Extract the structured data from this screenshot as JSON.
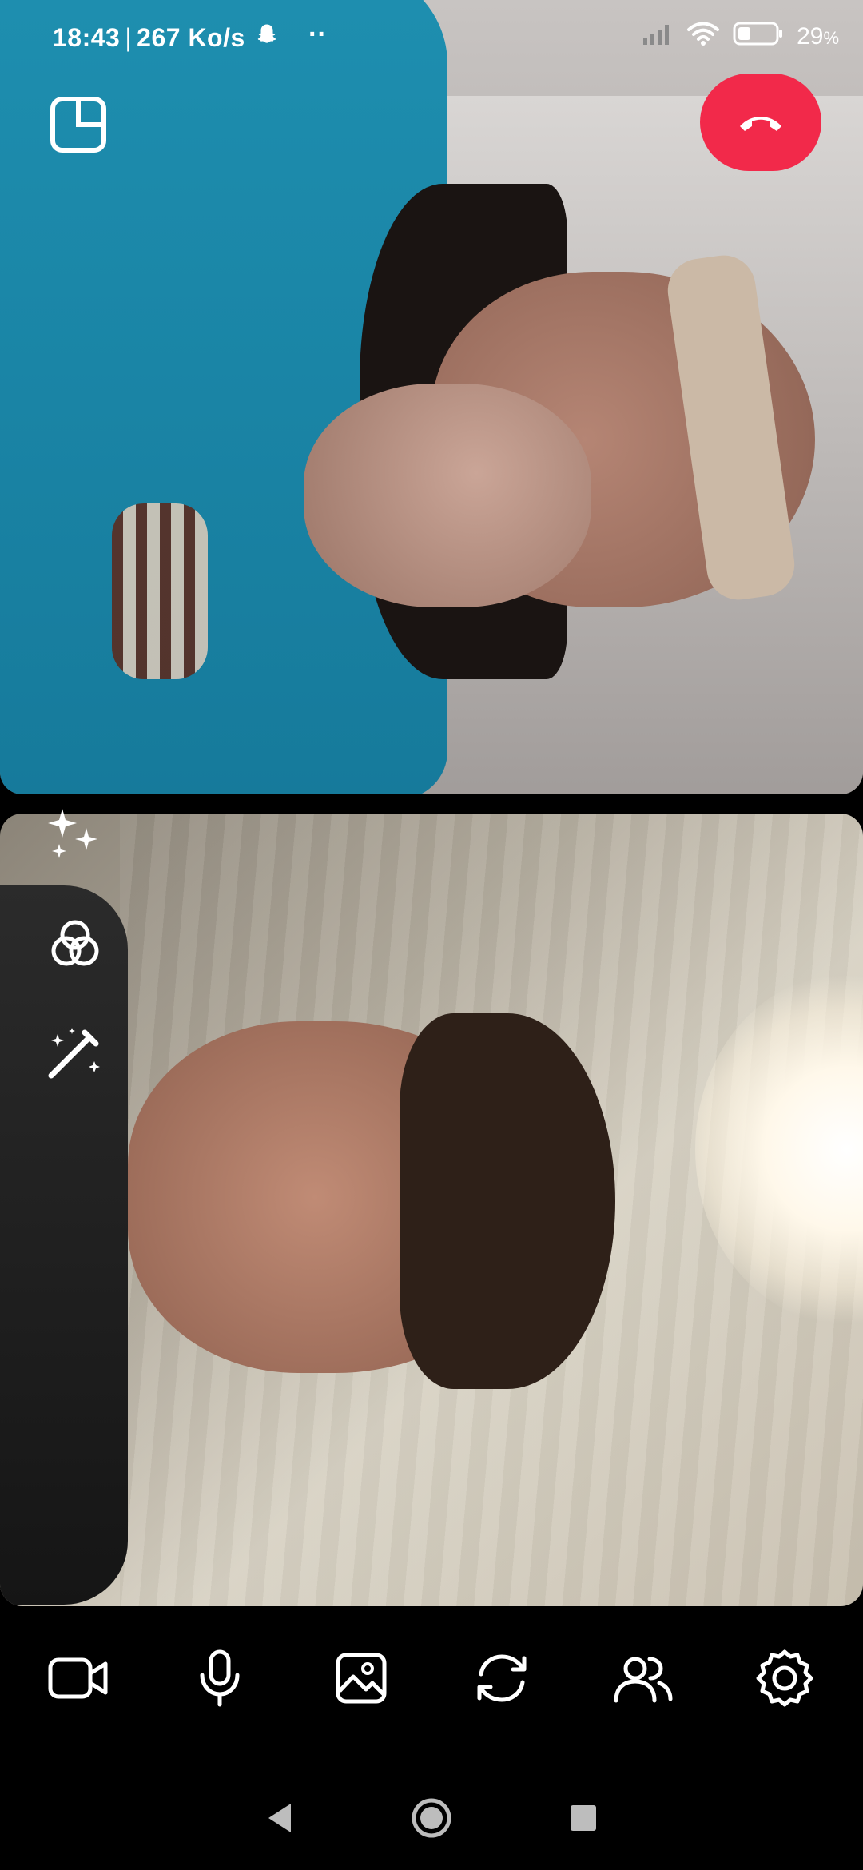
{
  "status_bar": {
    "time": "18:43",
    "net_speed": "267 Ko/s",
    "separator": "|",
    "more_dots": "··",
    "battery_percent": "29",
    "battery_unit": "%"
  },
  "call": {
    "layout_icon": "layout-split-icon",
    "end_call_icon": "phone-hangup-icon",
    "end_call_color": "#f2294a"
  },
  "side_tools": [
    {
      "icon": "sparkles-icon"
    },
    {
      "icon": "filters-icon"
    },
    {
      "icon": "magic-wand-icon"
    }
  ],
  "toolbar": [
    {
      "icon": "video-camera-icon"
    },
    {
      "icon": "microphone-icon"
    },
    {
      "icon": "image-icon"
    },
    {
      "icon": "switch-camera-icon"
    },
    {
      "icon": "participants-icon"
    },
    {
      "icon": "settings-icon"
    }
  ],
  "nav": [
    {
      "icon": "back-icon"
    },
    {
      "icon": "home-icon"
    },
    {
      "icon": "recents-icon"
    }
  ]
}
